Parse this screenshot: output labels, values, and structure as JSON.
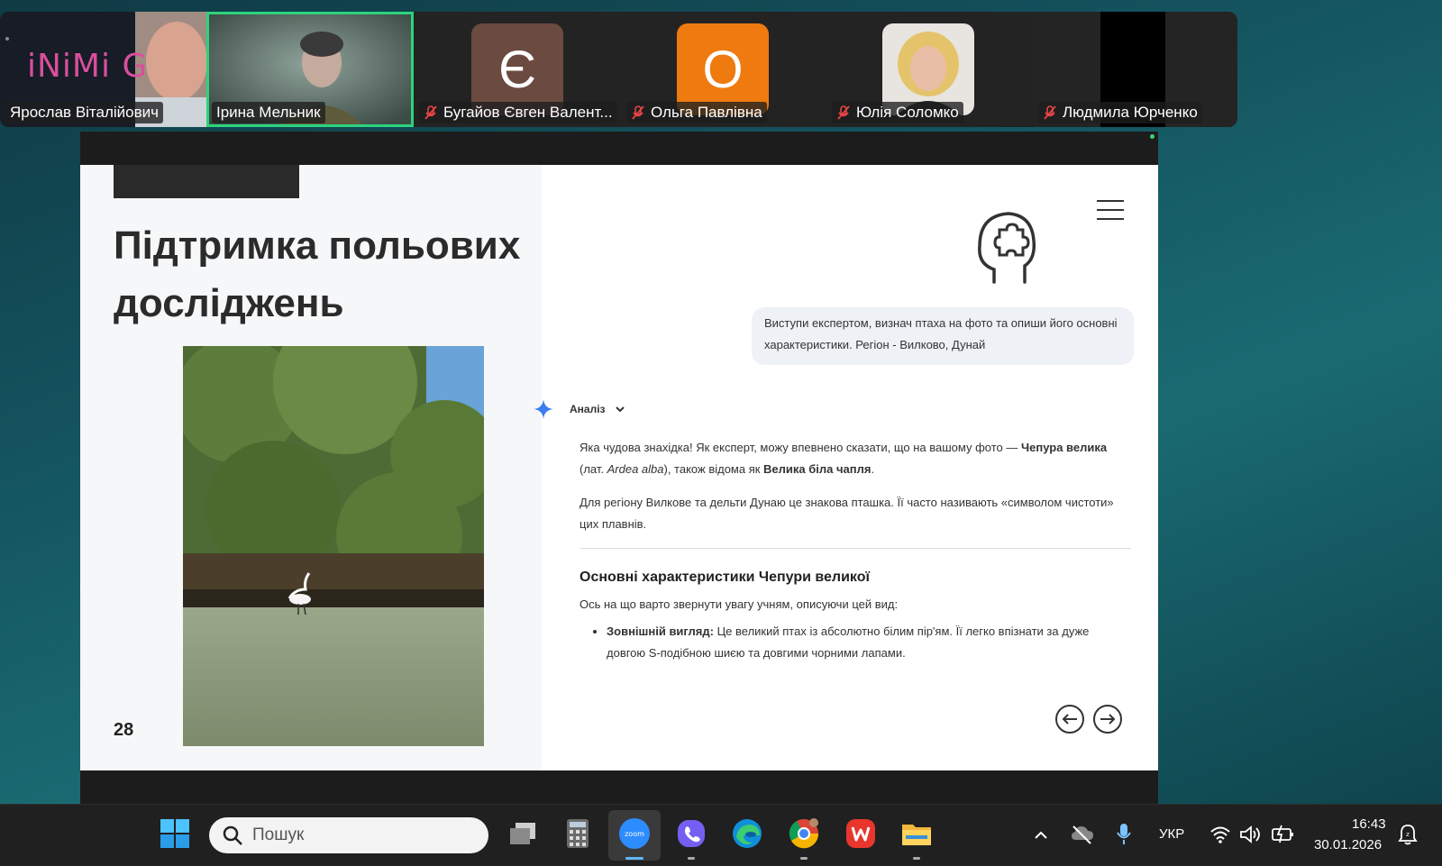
{
  "participants": [
    {
      "name": "Ярослав Віталійович",
      "overlay": "iNiMi Gemini",
      "muted": false
    },
    {
      "name": "Ірина Мельник",
      "muted": false,
      "active": true
    },
    {
      "name": "Бугайов Євген Валент...",
      "initial": "Є",
      "color": "#6b4a40",
      "muted": true
    },
    {
      "name": "Ольга Павлівна",
      "initial": "О",
      "color": "#ee7a10",
      "muted": true
    },
    {
      "name": "Юлія Соломко",
      "muted": true
    },
    {
      "name": "Людмила Юрченко",
      "muted": true
    }
  ],
  "slide": {
    "title": "Підтримка польових досліджень",
    "page_number": "28",
    "prompt": "Виступи експертом, визнач птаха на фото та опиши його основні характеристики. Регіон - Вилково, Дунай",
    "analysis_label": "Аналіз",
    "response": {
      "p1_a": "Яка чудова знахідка! Як експерт, можу впевнено сказати, що на вашому фото — ",
      "p1_b": "Чепура велика",
      "p1_c": " (лат. ",
      "p1_d": "Ardea alba",
      "p1_e": "), також відома як ",
      "p1_f": "Велика біла чапля",
      "p1_g": ".",
      "p2": "Для регіону Вилкове та дельти Дунаю це знакова пташка. Її часто називають «символом чистоти» цих плавнів.",
      "heading": "Основні характеристики Чепури великої",
      "intro": "Ось на що варто звернути увагу учням, описуючи цей вид:",
      "bullet_label": "Зовнішній вигляд:",
      "bullet_text": " Це великий птах із абсолютно білим пір'ям. Її легко впізнати за дуже довгою S-подібною шиєю та довгими чорними лапами."
    }
  },
  "taskbar": {
    "search_placeholder": "Пошук",
    "apps": [
      "start",
      "task-view",
      "calculator",
      "zoom",
      "viber",
      "edge",
      "chrome",
      "wps-office",
      "file-explorer"
    ],
    "language": "УКР",
    "time": "16:43",
    "date": "30.01.2026"
  }
}
